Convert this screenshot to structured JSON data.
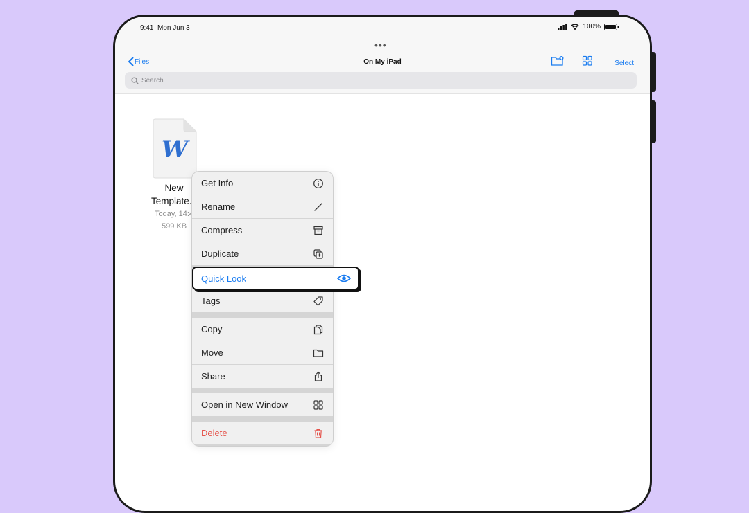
{
  "status": {
    "time": "9:41",
    "date": "Mon Jun 3",
    "battery": "100%"
  },
  "nav": {
    "back_label": "Files",
    "title": "On My iPad",
    "select_label": "Select"
  },
  "search": {
    "placeholder": "Search"
  },
  "file": {
    "name_line1": "New",
    "name_line2": "Template.d",
    "date": "Today, 14:4",
    "size": "599 KB",
    "glyph": "W"
  },
  "menu": {
    "get_info": "Get Info",
    "rename": "Rename",
    "compress": "Compress",
    "duplicate": "Duplicate",
    "quick_look": "Quick Look",
    "tags": "Tags",
    "copy": "Copy",
    "move": "Move",
    "share": "Share",
    "open_new_window": "Open in New Window",
    "delete": "Delete"
  },
  "colors": {
    "background": "#d9c9fb",
    "accent": "#1a7cf0",
    "destructive": "#e5534b",
    "word_blue": "#2f6fd0"
  }
}
